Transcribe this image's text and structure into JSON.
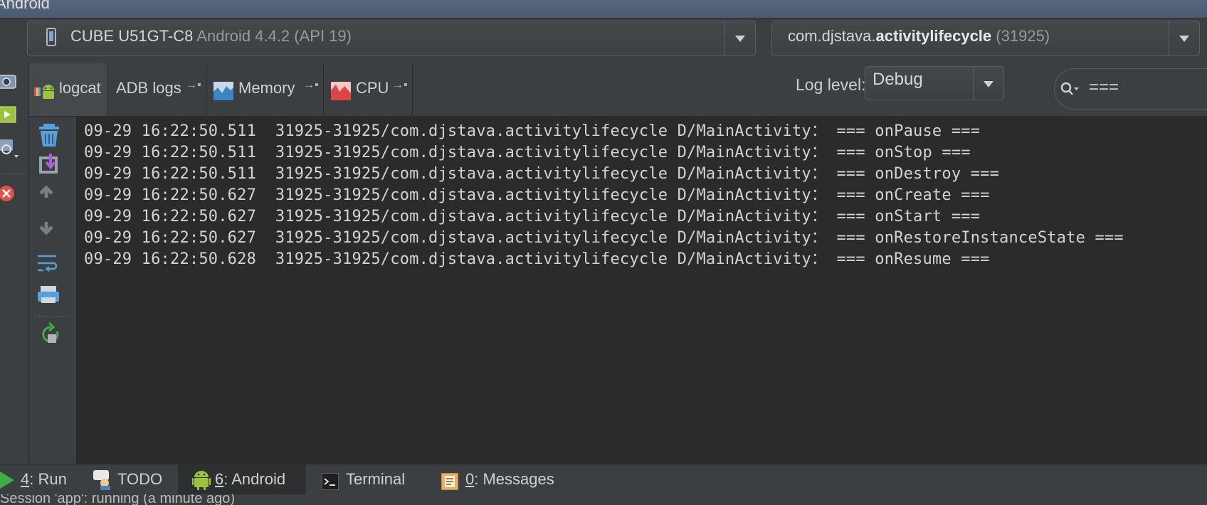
{
  "window": {
    "title": "Android"
  },
  "device_selector": {
    "device": "CUBE U51GT-C8",
    "version": "Android 4.4.2 (API 19)"
  },
  "process_selector": {
    "package_prefix": "com.djstava.",
    "package_bold": "activitylifecycle",
    "pid": "(31925)"
  },
  "tabs": [
    {
      "label": "logcat"
    },
    {
      "label": "ADB logs"
    },
    {
      "label": "Memory"
    },
    {
      "label": "CPU"
    }
  ],
  "log_level": {
    "label": "Log level:",
    "value": "Debug"
  },
  "search": {
    "value": "==="
  },
  "log_lines": [
    "09-29 16:22:50.511  31925-31925/com.djstava.activitylifecycle D/MainActivity： === onPause ===",
    "09-29 16:22:50.511  31925-31925/com.djstava.activitylifecycle D/MainActivity： === onStop ===",
    "09-29 16:22:50.511  31925-31925/com.djstava.activitylifecycle D/MainActivity： === onDestroy ===",
    "09-29 16:22:50.627  31925-31925/com.djstava.activitylifecycle D/MainActivity： === onCreate ===",
    "09-29 16:22:50.627  31925-31925/com.djstava.activitylifecycle D/MainActivity： === onStart ===",
    "09-29 16:22:50.627  31925-31925/com.djstava.activitylifecycle D/MainActivity： === onRestoreInstanceState ===",
    "09-29 16:22:50.628  31925-31925/com.djstava.activitylifecycle D/MainActivity： === onResume ==="
  ],
  "bottom_tabs": {
    "run": {
      "mnemonic": "4",
      "label": ": Run"
    },
    "todo": {
      "label": "TODO"
    },
    "android": {
      "mnemonic": "6",
      "label": ": Android"
    },
    "terminal": {
      "label": "Terminal"
    },
    "messages": {
      "mnemonic": "0",
      "label": ": Messages"
    }
  },
  "status_bar": {
    "text": "Session 'app': running (a minute ago)"
  },
  "colors": {
    "background": "#3c3f41",
    "log_background": "#2b2b2b",
    "run_green": "#3cb043"
  }
}
